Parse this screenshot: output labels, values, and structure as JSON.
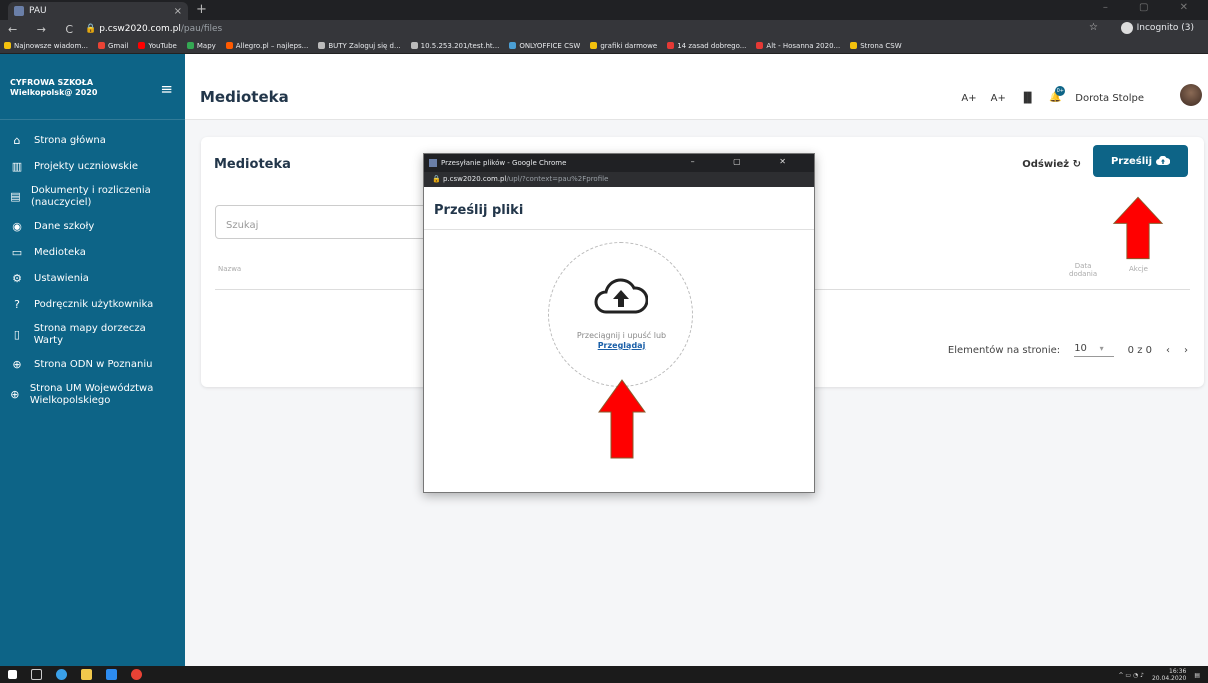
{
  "browser": {
    "tab_title": "PAU",
    "tab_close": "×",
    "new_tab": "+",
    "nav": "← → C",
    "url_host": "p.csw2020.com.pl",
    "url_path": "/pau/files",
    "incognito": "Incognito (3)",
    "bookmarks": [
      {
        "label": "Najnowsze wiadom...",
        "color": "#f4c20d"
      },
      {
        "label": "Gmail",
        "color": "#ea4335"
      },
      {
        "label": "YouTube",
        "color": "#ff0000"
      },
      {
        "label": "Mapy",
        "color": "#34a853"
      },
      {
        "label": "Allegro.pl – najleps...",
        "color": "#ff5a00"
      },
      {
        "label": "BUTY Zaloguj się d...",
        "color": "#bbbbbb"
      },
      {
        "label": "10.5.253.201/test.ht...",
        "color": "#bbbbbb"
      },
      {
        "label": "ONLYOFFICE CSW",
        "color": "#4b9fd5"
      },
      {
        "label": "grafiki darmowe",
        "color": "#f4c20d"
      },
      {
        "label": "14 zasad dobrego...",
        "color": "#e53935"
      },
      {
        "label": "Alt - Hosanna 2020...",
        "color": "#e53935"
      },
      {
        "label": "Strona CSW",
        "color": "#f4c20d"
      }
    ]
  },
  "sidebar": {
    "brand_line1": "CYFROWA SZKOŁA",
    "brand_line2": "Wielkopolsk@ 2020",
    "items": [
      {
        "label": "Strona główna",
        "icon": "home-icon",
        "glyph": "⌂"
      },
      {
        "label": "Projekty uczniowskie",
        "icon": "chart-icon",
        "glyph": "▥"
      },
      {
        "label": "Dokumenty i rozliczenia (nauczyciel)",
        "icon": "document-icon",
        "glyph": "▤"
      },
      {
        "label": "Dane szkoły",
        "icon": "shield-icon",
        "glyph": "◉"
      },
      {
        "label": "Medioteka",
        "icon": "folder-icon",
        "glyph": "▭"
      },
      {
        "label": "Ustawienia",
        "icon": "gear-icon",
        "glyph": "⚙"
      },
      {
        "label": "Podręcznik użytkownika",
        "icon": "help-icon",
        "glyph": "?"
      },
      {
        "label": "Strona mapy dorzecza Warty",
        "icon": "map-icon",
        "glyph": "▯"
      },
      {
        "label": "Strona ODN w Poznaniu",
        "icon": "globe-icon",
        "glyph": "⊕"
      },
      {
        "label": "Strona UM Województwa Wielkopolskiego",
        "icon": "globe-icon",
        "glyph": "⊕"
      }
    ]
  },
  "header": {
    "title": "Medioteka",
    "font_up": "A+",
    "font_up2": "A+",
    "notif_count": "0+",
    "user_name": "Dorota Stolpe"
  },
  "card": {
    "title": "Medioteka",
    "refresh_label": "Odśwież",
    "send_label": "Prześlij",
    "search_placeholder": "Szukaj",
    "col_name": "Nazwa",
    "col_date_l1": "Data",
    "col_date_l2": "dodania",
    "col_actions": "Akcje",
    "per_page_label": "Elementów na stronie:",
    "per_page_value": "10",
    "range": "0 z 0"
  },
  "popup": {
    "window_title": "Przesyłanie plików - Google Chrome",
    "url_host": "p.csw2020.com.pl",
    "url_path": "/upl/?context=pau%2Fprofile",
    "heading": "Prześlij pliki",
    "drop_text": "Przeciągnij i upuść lub",
    "browse_link": "Przeglądaj"
  },
  "taskbar": {
    "time": "16:36",
    "date": "20.04.2020"
  },
  "colors": {
    "brand": "#0d6487",
    "arrow": "#ff0000"
  }
}
